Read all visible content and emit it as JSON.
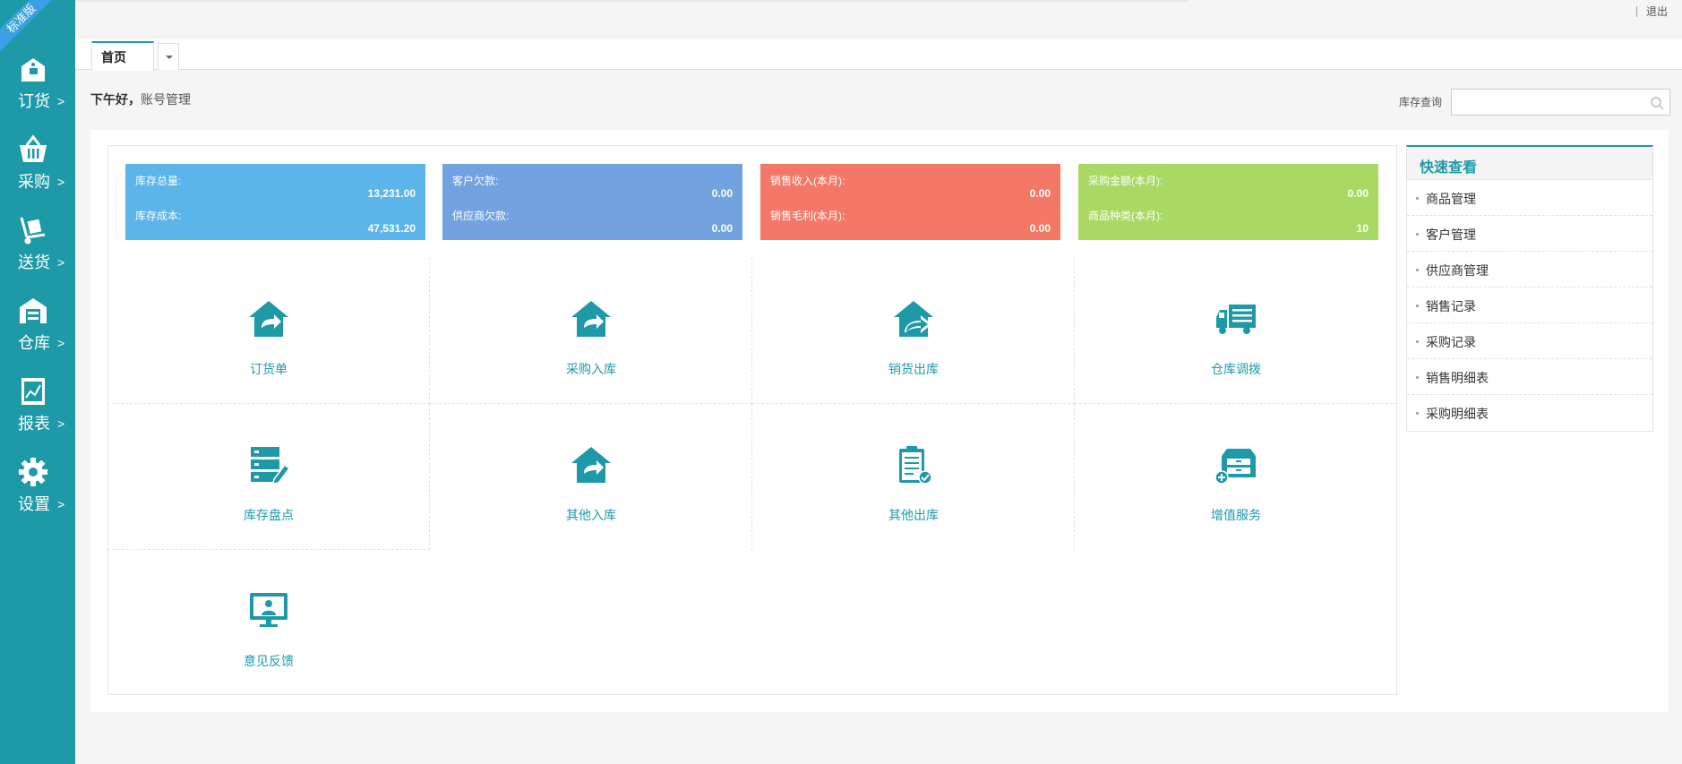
{
  "ribbon": "标准版",
  "sidebar": {
    "items": [
      {
        "label": "订货",
        "icon": "order-tag-icon"
      },
      {
        "label": "采购",
        "icon": "basket-icon"
      },
      {
        "label": "送货",
        "icon": "hand-truck-icon"
      },
      {
        "label": "仓库",
        "icon": "warehouse-icon"
      },
      {
        "label": "报表",
        "icon": "report-chart-icon"
      },
      {
        "label": "设置",
        "icon": "gear-icon"
      }
    ],
    "arrow": ">"
  },
  "header": {
    "logout": "退出"
  },
  "tabs": [
    {
      "label": "首页"
    }
  ],
  "greeting": {
    "hello": "下午好，",
    "account": "账号管理"
  },
  "search": {
    "label": "库存查询",
    "value": "",
    "placeholder": ""
  },
  "stats": [
    {
      "label1": "库存总量:",
      "value1": "13,231.00",
      "label2": "库存成本:",
      "value2": "47,531.20",
      "color": "#5bb4ea"
    },
    {
      "label1": "客户欠款:",
      "value1": "0.00",
      "label2": "供应商欠款:",
      "value2": "0.00",
      "color": "#72a3e0"
    },
    {
      "label1": "销售收入(本月):",
      "value1": "0.00",
      "label2": "销售毛利(本月):",
      "value2": "0.00",
      "color": "#f47866"
    },
    {
      "label1": "采购金额(本月):",
      "value1": "0.00",
      "label2": "商品种类(本月):",
      "value2": "10",
      "color": "#a9d964"
    }
  ],
  "shortcuts": [
    {
      "label": "订货单",
      "icon": "house-arrow-icon"
    },
    {
      "label": "采购入库",
      "icon": "house-arrow-icon"
    },
    {
      "label": "销货出库",
      "icon": "house-out-icon"
    },
    {
      "label": "仓库调拨",
      "icon": "truck-icon"
    },
    {
      "label": "库存盘点",
      "icon": "server-edit-icon"
    },
    {
      "label": "其他入库",
      "icon": "house-arrow-icon"
    },
    {
      "label": "其他出库",
      "icon": "clipboard-check-icon"
    },
    {
      "label": "增值服务",
      "icon": "cabinet-plus-icon"
    },
    {
      "label": "意见反馈",
      "icon": "monitor-user-icon"
    }
  ],
  "quick": {
    "title": "快速查看",
    "items": [
      "商品管理",
      "客户管理",
      "供应商管理",
      "销售记录",
      "采购记录",
      "销售明细表",
      "采购明细表"
    ]
  },
  "colors": {
    "accent": "#1e99a8"
  }
}
